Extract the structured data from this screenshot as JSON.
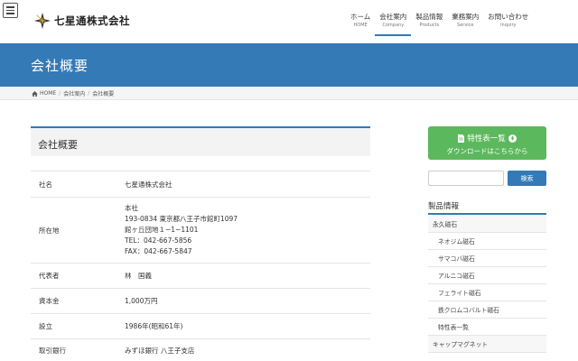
{
  "header": {
    "logo_text": "七星通株式会社",
    "nav": [
      {
        "jp": "ホーム",
        "en": "HOME"
      },
      {
        "jp": "会社案内",
        "en": "Company"
      },
      {
        "jp": "製品情報",
        "en": "Products"
      },
      {
        "jp": "業務案内",
        "en": "Service"
      },
      {
        "jp": "お問い合わせ",
        "en": "Inquiry"
      }
    ]
  },
  "page_title": "会社概要",
  "breadcrumb": [
    "HOME",
    "会社案内",
    "会社概要"
  ],
  "content": {
    "title": "会社概要",
    "rows": [
      {
        "label": "社名",
        "value": "七星通株式会社"
      },
      {
        "label": "所在地",
        "lines": [
          "本社",
          "193-0834 東京都八王子市館町1097",
          "館ヶ丘団地１−1−1101",
          "TEL：042-667-5856",
          "FAX：042-667-5847"
        ]
      },
      {
        "label": "代表者",
        "value": "林　国義"
      },
      {
        "label": "資本金",
        "value": "1,000万円"
      },
      {
        "label": "設立",
        "value": "1986年(昭和61年)"
      },
      {
        "label": "取引銀行",
        "value": "みずほ銀行 八王子支店"
      }
    ]
  },
  "sidebar": {
    "spec_button_line1": "特性表一覧",
    "spec_button_line2": "ダウンロードはこちらから",
    "search_placeholder": "",
    "search_button": "検索",
    "products_title": "製品情報",
    "products": [
      {
        "label": "永久磁石",
        "sub": false
      },
      {
        "label": "ネオジム磁石",
        "sub": true
      },
      {
        "label": "サマコバ磁石",
        "sub": true
      },
      {
        "label": "アルニコ磁石",
        "sub": true
      },
      {
        "label": "フェライト磁石",
        "sub": true
      },
      {
        "label": "鉄クロムコバルト磁石",
        "sub": true
      },
      {
        "label": "特性表一覧",
        "sub": true
      },
      {
        "label": "キャップマグネット",
        "sub": false
      }
    ]
  },
  "colors": {
    "primary": "#337ab7",
    "button_green": "#5cb85c"
  }
}
